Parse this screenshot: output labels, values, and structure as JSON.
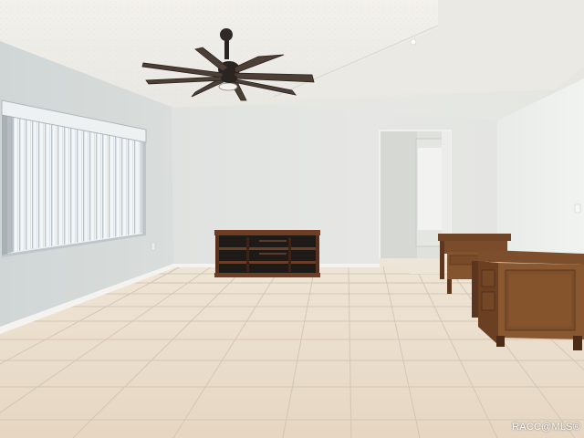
{
  "photo": {
    "watermark": "RACC@MLS®"
  }
}
